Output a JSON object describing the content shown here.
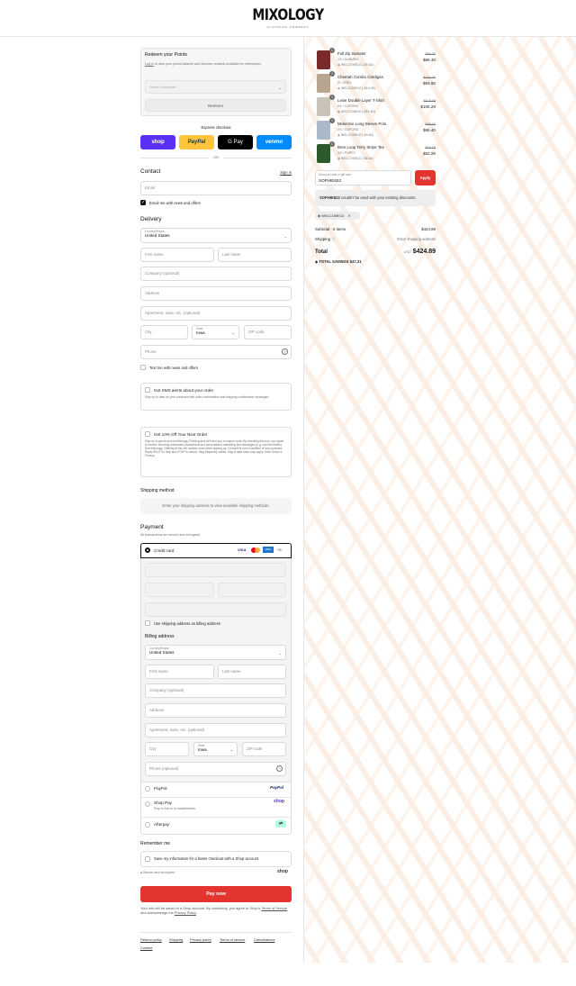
{
  "header": {
    "logo": "MIXOLOGY",
    "logo_sub": "CLOTHING COMPANY"
  },
  "points": {
    "title": "Redeem your Points",
    "text_link": "Log in",
    "text_rest": " to view your points balance and discover rewards available for redemption.",
    "select_placeholder": "Select a discount",
    "button": "Redeem"
  },
  "express": {
    "title": "Express checkout",
    "shop": "shop",
    "paypal": "PayPal",
    "gpay": "G Pay",
    "venmo": "venmo",
    "or": "OR"
  },
  "contact": {
    "title": "Contact",
    "signin": "Sign in",
    "email_placeholder": "Email",
    "news_label": "Email me with news and offers"
  },
  "delivery": {
    "title": "Delivery",
    "country_label": "Country/Region",
    "country": "United States",
    "first": "First name",
    "last": "Last name",
    "company": "Company (optional)",
    "address": "Address",
    "apt": "Apartment, suite, etc. (optional)",
    "city": "City",
    "state_label": "State",
    "state": "Iowa",
    "zip": "ZIP code",
    "phone": "Phone",
    "text_news": "Text me with news and offers"
  },
  "sms": {
    "title": "Get SMS alerts about your order",
    "text": "Stay up to date on your purchase with order confirmation and shipping confirmation messages."
  },
  "promo": {
    "title": "Get 10% Off Your Next Order",
    "text": "Sign up to get texts from Mixology Clothing and we'll text you a coupon code. By checking this box, you agree to receive recurring automated promotional and personalized marketing text messages (e.g. cart reminders) from Mixology Clothing at the cell number used when signing up. Consent is not a condition of any purchase. Reply HELP for help and STOP to cancel. Msg frequency varies. Msg & data rates may apply. View Terms & Privacy."
  },
  "shipping": {
    "title": "Shipping method",
    "text": "Enter your shipping address to view available shipping methods."
  },
  "payment": {
    "title": "Payment",
    "subtitle": "All transactions are secure and encrypted.",
    "credit": "Credit card",
    "card_more": "+5",
    "use_shipping": "Use shipping address as billing address",
    "billing_title": "Billing address",
    "paypal": "PayPal",
    "shoppay": "Shop Pay",
    "shoppay_sub": "Pay in full or in installments",
    "shoppay_logo": "shop",
    "afterpay": "Afterpay"
  },
  "billing": {
    "country_label": "Country/Region",
    "country": "United States",
    "first": "First name",
    "last": "Last name",
    "company": "Company (optional)",
    "address": "Address",
    "apt": "Apartment, suite, etc. (optional)",
    "city": "City",
    "state_label": "State",
    "state": "Iowa",
    "zip": "ZIP code",
    "phone": "Phone (optional)"
  },
  "remember": {
    "title": "Remember me",
    "save": "Save my information for a faster checkout with a Shop account",
    "secure": "Secure and encrypted",
    "shop": "shop"
  },
  "pay": {
    "button": "Pay now",
    "legal_1": "Your info will be saved to a Shop account. By continuing, you agree to Shop's ",
    "terms": "Terms of Service",
    "legal_2": " and acknowledge the ",
    "privacy": "Privacy Policy",
    "legal_3": "."
  },
  "footer": {
    "links": [
      "Refund policy",
      "Shipping",
      "Privacy policy",
      "Terms of service",
      "Cancellations"
    ],
    "contact": "Contact"
  },
  "cart": {
    "items": [
      {
        "qty": "1",
        "name": "Full Zip Sweater",
        "variant": "XS / AUBURN",
        "discount": "WELCOME10 (-$9.60)",
        "old": "$96.00",
        "new": "$86.40",
        "color": "#7a2a2a"
      },
      {
        "qty": "1",
        "name": "Cheetah Combo Cardigan",
        "variant": "S / GREY",
        "discount": "WELCOME10 (-$10.40)",
        "old": "$104.00",
        "new": "$93.60",
        "color": "#b7a590"
      },
      {
        "qty": "1",
        "name": "Lexie Double Layer T-Shirt",
        "variant": "XS / OXFORD",
        "discount": "WELCOME10 (-$11.80)",
        "old": "$118.00",
        "new": "$106.20",
        "color": "#c9c2b8"
      },
      {
        "qty": "1",
        "name": "Mckenzie Long Sleeve Polo",
        "variant": "XS / OXFORD",
        "discount": "WELCOME10 (-$9.60)",
        "old": "$96.00",
        "new": "$86.40",
        "color": "#aab8c8"
      },
      {
        "qty": "1",
        "name": "Bree Loop Terry Stripe Tee",
        "variant": "XS / POPPY",
        "discount": "WELCOME10 (-$5.81)",
        "old": "$58.10",
        "new": "$52.29",
        "color": "#2d5a2d"
      }
    ],
    "code_label": "Discount code or gift card",
    "code_value": "SOPHIE822",
    "apply": "Apply",
    "error_code": "SOPHIE822",
    "error_rest": " couldn't be used with your existing discounts.",
    "tag": "WELCOME10",
    "subtotal_label": "Subtotal · 5 items",
    "subtotal": "$424.89",
    "shipping_label": "Shipping",
    "shipping_value": "Enter shipping address",
    "total_label": "Total",
    "currency": "USD",
    "total": "$424.89",
    "savings_label": "TOTAL SAVINGS",
    "savings": "$47.21"
  },
  "colors": {
    "shop": "#5a31f4",
    "paypal": "#ffc439",
    "venmo": "#008cff",
    "pay": "#e3342f",
    "apply": "#e3342f"
  }
}
